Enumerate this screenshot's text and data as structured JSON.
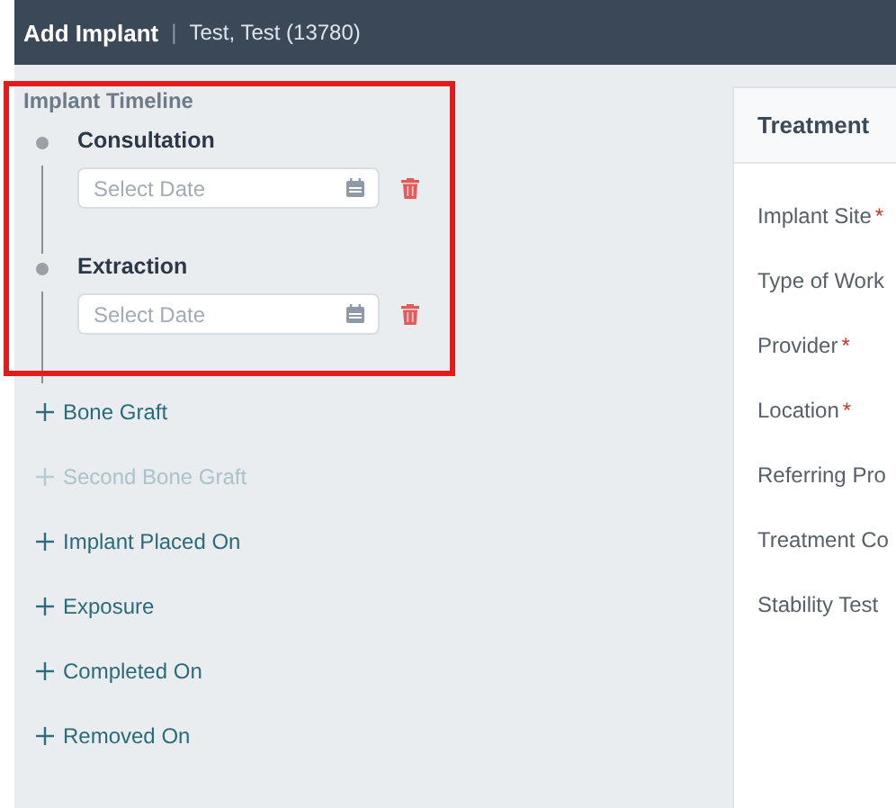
{
  "header": {
    "title": "Add Implant",
    "separator": "|",
    "patient": "Test, Test (13780)"
  },
  "timeline": {
    "title": "Implant Timeline",
    "events": [
      {
        "label": "Consultation",
        "placeholder": "Select Date"
      },
      {
        "label": "Extraction",
        "placeholder": "Select Date"
      }
    ],
    "add_actions": [
      {
        "label": "Bone Graft",
        "disabled": false
      },
      {
        "label": "Second Bone Graft",
        "disabled": true
      },
      {
        "label": "Implant Placed On",
        "disabled": false
      },
      {
        "label": "Exposure",
        "disabled": false
      },
      {
        "label": "Completed On",
        "disabled": false
      },
      {
        "label": "Removed On",
        "disabled": false
      }
    ]
  },
  "treatment_panel": {
    "title": "Treatment",
    "fields": [
      {
        "label": "Implant Site",
        "required_mark": "*"
      },
      {
        "label": "Type of Work"
      },
      {
        "label": "Provider",
        "required_mark": "*"
      },
      {
        "label": "Location",
        "required_mark": "*"
      },
      {
        "label": "Referring Pro"
      },
      {
        "label": "Treatment Co"
      },
      {
        "label": "Stability Test"
      }
    ]
  }
}
